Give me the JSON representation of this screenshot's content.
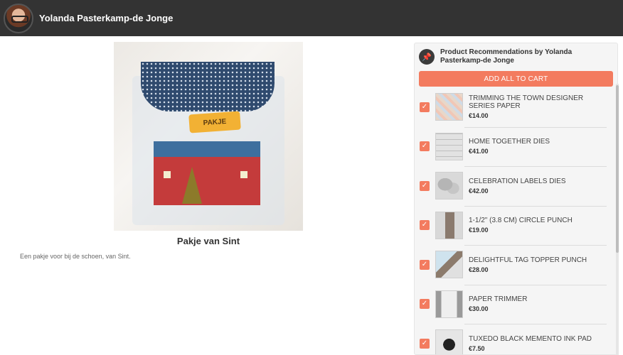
{
  "header": {
    "author_name": "Yolanda Pasterkamp-de Jonge",
    "avatar_icon": "avatar-photo"
  },
  "main": {
    "image_label": "PAKJE",
    "title": "Pakje van Sint",
    "description": "Een pakje voor bij de schoen, van Sint."
  },
  "recommendations": {
    "pin_icon": "pin-icon",
    "title": "Product Recommendations by Yolanda Pasterkamp-de Jonge",
    "add_all_label": "ADD ALL TO CART",
    "accent_color": "#f37b5f",
    "items": [
      {
        "name": "TRIMMING THE TOWN DESIGNER SERIES PAPER",
        "price": "€14.00",
        "checked": true
      },
      {
        "name": "HOME TOGETHER DIES",
        "price": "€41.00",
        "checked": true
      },
      {
        "name": "CELEBRATION LABELS DIES",
        "price": "€42.00",
        "checked": true
      },
      {
        "name": "1-1/2\" (3.8 CM) CIRCLE PUNCH",
        "price": "€19.00",
        "checked": true
      },
      {
        "name": "DELIGHTFUL TAG TOPPER PUNCH",
        "price": "€28.00",
        "checked": true
      },
      {
        "name": "PAPER TRIMMER",
        "price": "€30.00",
        "checked": true
      },
      {
        "name": "TUXEDO BLACK MEMENTO INK PAD",
        "price": "€7.50",
        "checked": true
      }
    ]
  }
}
